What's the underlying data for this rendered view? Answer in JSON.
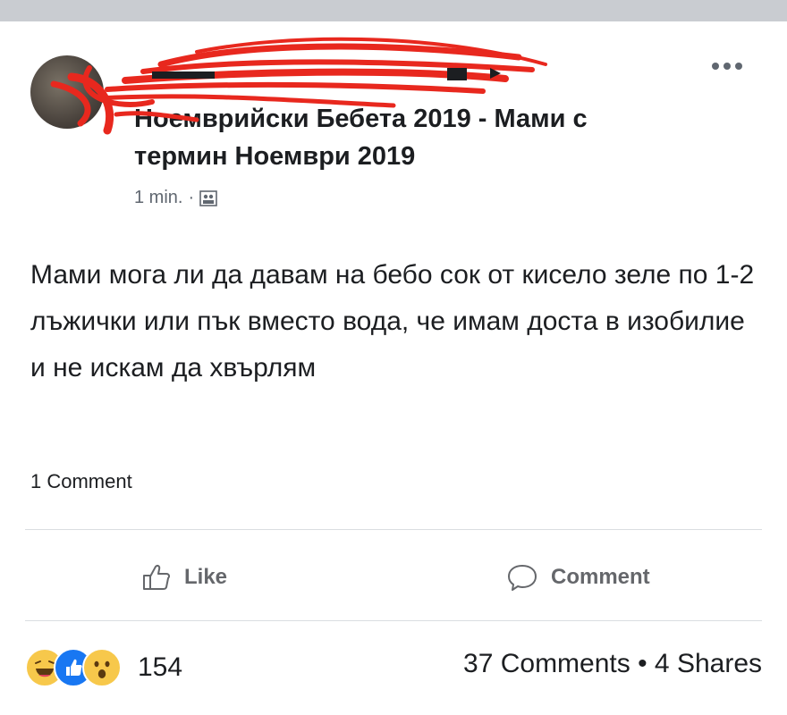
{
  "post": {
    "group_name": "Ноемврийски Бебета 2019 - Мами с термин Ноември 2019",
    "time": "1 min.",
    "separator": "·",
    "text": "Мами мога ли да давам на бебо сок от кисело зеле по 1-2 лъжички или пък вместо вода, че имам доста в изобилие и не искам да хвърлям",
    "comment_count_label": "1 Comment"
  },
  "actions": {
    "like_label": "Like",
    "comment_label": "Comment"
  },
  "footer": {
    "reaction_icons": [
      "haha-icon",
      "like-icon",
      "wow-icon"
    ],
    "reaction_count": "154",
    "stats": "37 Comments • 4 Shares"
  },
  "colors": {
    "text": "#1c1e21",
    "secondary": "#65676b",
    "scribble": "#e8281e",
    "like_blue": "#1877f2",
    "emoji_yellow": "#f7c84b"
  }
}
